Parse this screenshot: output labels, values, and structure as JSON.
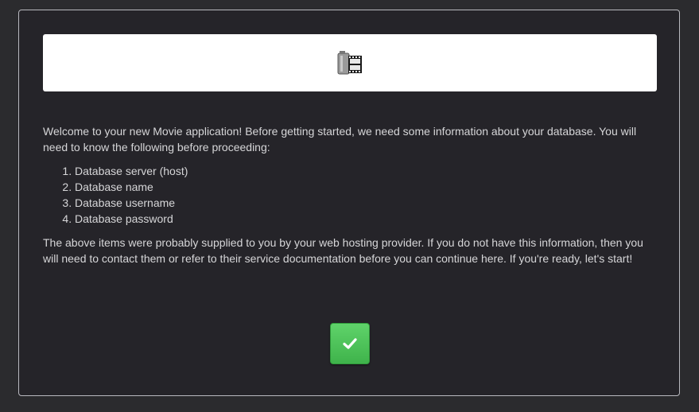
{
  "logo": {
    "icon": "film-icon"
  },
  "intro": {
    "text": "Welcome to your new Movie application! Before getting started, we need some information about your database. You will need to know the following before proceeding:"
  },
  "requirements": [
    {
      "label": "Database server (host)"
    },
    {
      "label": "Database name"
    },
    {
      "label": "Database username"
    },
    {
      "label": "Database password"
    }
  ],
  "note": {
    "text": "The above items were probably supplied to you by your web hosting provider. If you do not have this information, then you will need to contact them or refer to their service documentation before you can continue here. If you're ready, let's start!"
  },
  "actions": {
    "continue_icon": "checkmark-icon",
    "accent": "#4cc457"
  }
}
